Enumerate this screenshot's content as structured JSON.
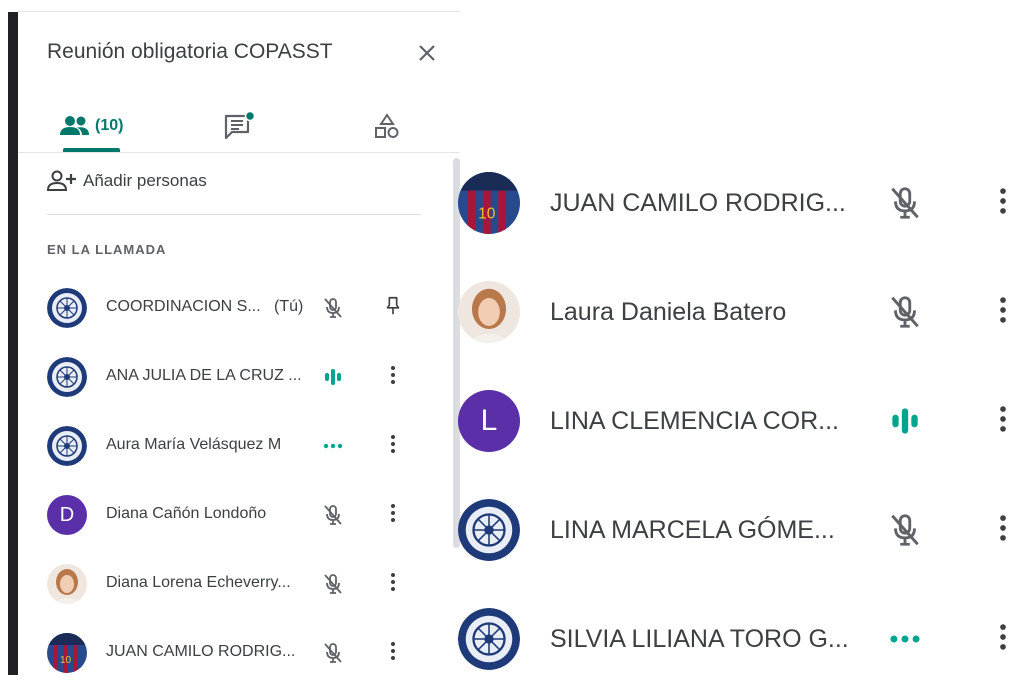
{
  "meeting": {
    "title": "Reunión obligatoria COPASST"
  },
  "tabs": {
    "people_count": "(10)"
  },
  "add_people": {
    "label": "Añadir personas"
  },
  "section_label": "EN LA LLAMADA",
  "panel_participants": [
    {
      "name": "COORDINACION S...",
      "you_tag": "(Tú)",
      "avatar": "seal",
      "status_icon": "mic-off-icon",
      "action_icon": "pin-icon"
    },
    {
      "name": "ANA JULIA DE LA CRUZ ...",
      "avatar": "seal",
      "status_icon": "speaking-icon",
      "action_icon": "more-vert-icon"
    },
    {
      "name": "Aura María Velásquez M",
      "avatar": "seal",
      "status_icon": "ellipsis-icon",
      "action_icon": "more-vert-icon"
    },
    {
      "name": "Diana Cañón Londoño",
      "avatar": "letter",
      "initial": "D",
      "status_icon": "mic-off-icon",
      "action_icon": "more-vert-icon"
    },
    {
      "name": "Diana Lorena Echeverry...",
      "avatar": "photo",
      "status_icon": "mic-off-icon",
      "action_icon": "more-vert-icon"
    },
    {
      "name": "JUAN CAMILO RODRIG...",
      "avatar": "photo-jersey",
      "status_icon": "mic-off-icon",
      "action_icon": "more-vert-icon"
    }
  ],
  "grid_participants": [
    {
      "name": "JUAN CAMILO RODRIG...",
      "avatar": "photo-jersey",
      "status_icon": "mic-off-icon",
      "action_icon": "more-vert-icon"
    },
    {
      "name": "Laura Daniela Batero",
      "avatar": "photo",
      "status_icon": "mic-off-icon",
      "action_icon": "more-vert-icon"
    },
    {
      "name": "LINA CLEMENCIA COR...",
      "avatar": "letter",
      "initial": "L",
      "status_icon": "speaking-icon",
      "action_icon": "more-vert-icon"
    },
    {
      "name": "LINA MARCELA GÓME...",
      "avatar": "seal",
      "status_icon": "mic-off-icon",
      "action_icon": "more-vert-icon"
    },
    {
      "name": "SILVIA LILIANA TORO G...",
      "avatar": "seal",
      "status_icon": "ellipsis-icon",
      "action_icon": "more-vert-icon"
    }
  ],
  "colors": {
    "accent": "#00796b",
    "teal_indicator": "#00a58f",
    "avatar_purple": "#5b2fa8",
    "icon_gray": "#5f6368"
  }
}
